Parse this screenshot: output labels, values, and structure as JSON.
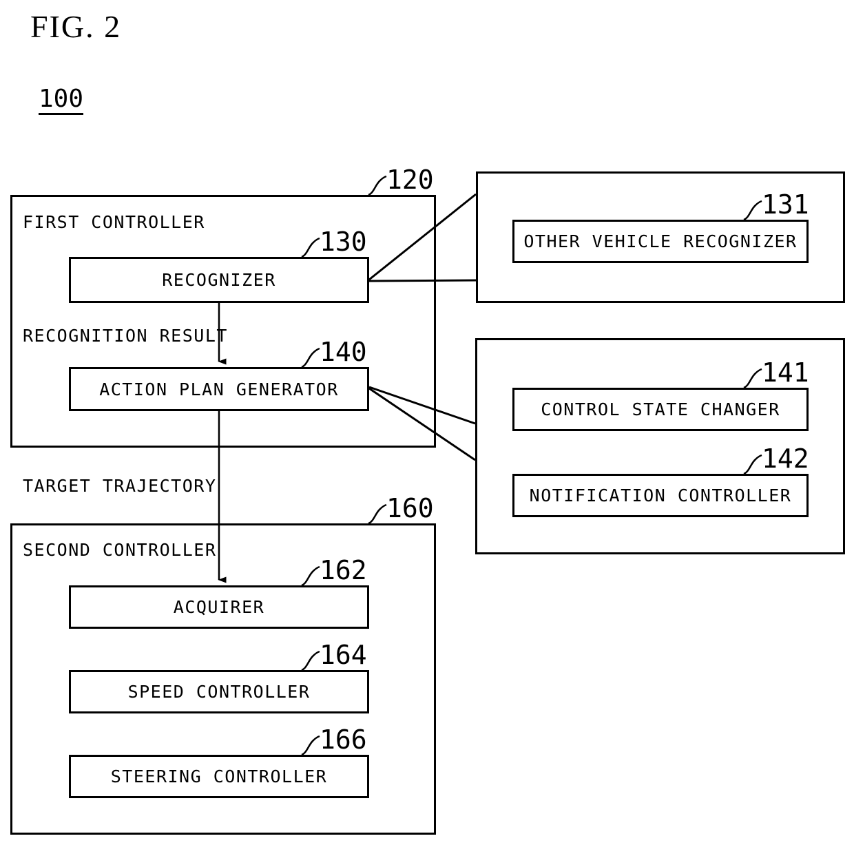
{
  "figure": {
    "title": "FIG. 2",
    "system_number": "100"
  },
  "first_controller": {
    "ref": "120",
    "caption": "FIRST CONTROLLER",
    "blocks": [
      {
        "ref": "130",
        "label": "RECOGNIZER"
      },
      {
        "ref": "140",
        "label": "ACTION PLAN GENERATOR"
      }
    ],
    "flow_labels": [
      "RECOGNITION RESULT"
    ]
  },
  "second_controller": {
    "ref": "160",
    "caption": "SECOND CONTROLLER",
    "blocks": [
      {
        "ref": "162",
        "label": "ACQUIRER"
      },
      {
        "ref": "164",
        "label": "SPEED CONTROLLER"
      },
      {
        "ref": "166",
        "label": "STEERING CONTROLLER"
      }
    ],
    "flow_labels": [
      "TARGET TRAJECTORY"
    ]
  },
  "recognizer_detail": {
    "blocks": [
      {
        "ref": "131",
        "label": "OTHER VEHICLE RECOGNIZER"
      }
    ]
  },
  "action_plan_detail": {
    "blocks": [
      {
        "ref": "141",
        "label": "CONTROL STATE CHANGER"
      },
      {
        "ref": "142",
        "label": "NOTIFICATION CONTROLLER"
      }
    ]
  },
  "style": {
    "line_color": "#000000",
    "background": "#ffffff"
  }
}
